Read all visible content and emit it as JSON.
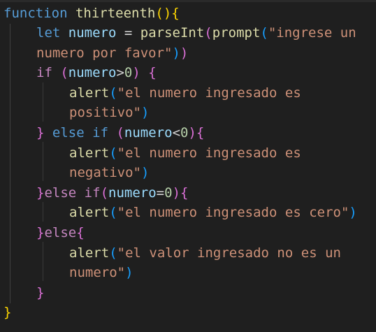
{
  "code": {
    "line1": {
      "keyword": "function",
      "name": "thirteenth",
      "paren_open": "(",
      "paren_close": ")",
      "brace": "{"
    },
    "line2": {
      "keyword": "let",
      "var": "numero",
      "op": "=",
      "fn1": "parseInt",
      "p1": "(",
      "fn2": "prompt",
      "p2": "(",
      "str": "\"ingrese un"
    },
    "line3": {
      "str": "numero por favor\"",
      "p2": ")",
      "p1": ")"
    },
    "line4": {
      "keyword": "if",
      "p": "(",
      "var": "numero",
      "op": ">",
      "num": "0",
      "pc": ")",
      "brace": "{"
    },
    "line5": {
      "fn": "alert",
      "p": "(",
      "str": "\"el numero ingresado es"
    },
    "line6": {
      "str": "positivo\"",
      "p": ")"
    },
    "line7": {
      "brace": "}",
      "kw1": "else",
      "kw2": "if",
      "p": "(",
      "var": "numero",
      "op": "<",
      "num": "0",
      "pc": ")",
      "brace2": "{"
    },
    "line8": {
      "fn": "alert",
      "p": "(",
      "str": "\"el numero ingresado es"
    },
    "line9": {
      "str": "negativo\"",
      "p": ")"
    },
    "line10": {
      "brace": "}",
      "kw1": "else",
      "kw2": "if",
      "p": "(",
      "var": "numero",
      "op": "=",
      "num": "0",
      "pc": ")",
      "brace2": "{"
    },
    "line11": {
      "fn": "alert",
      "p": "(",
      "str": "\"el numero ingresado es cero\"",
      "pc": ")"
    },
    "line12": {
      "brace": "}",
      "kw": "else",
      "brace2": "{"
    },
    "line13": {
      "fn": "alert",
      "p": "(",
      "str": "\"el valor ingresado no es un"
    },
    "line14": {
      "str": "numero\"",
      "p": ")"
    },
    "line15": {
      "brace": "}"
    },
    "line16": {
      "brace": "}"
    }
  }
}
